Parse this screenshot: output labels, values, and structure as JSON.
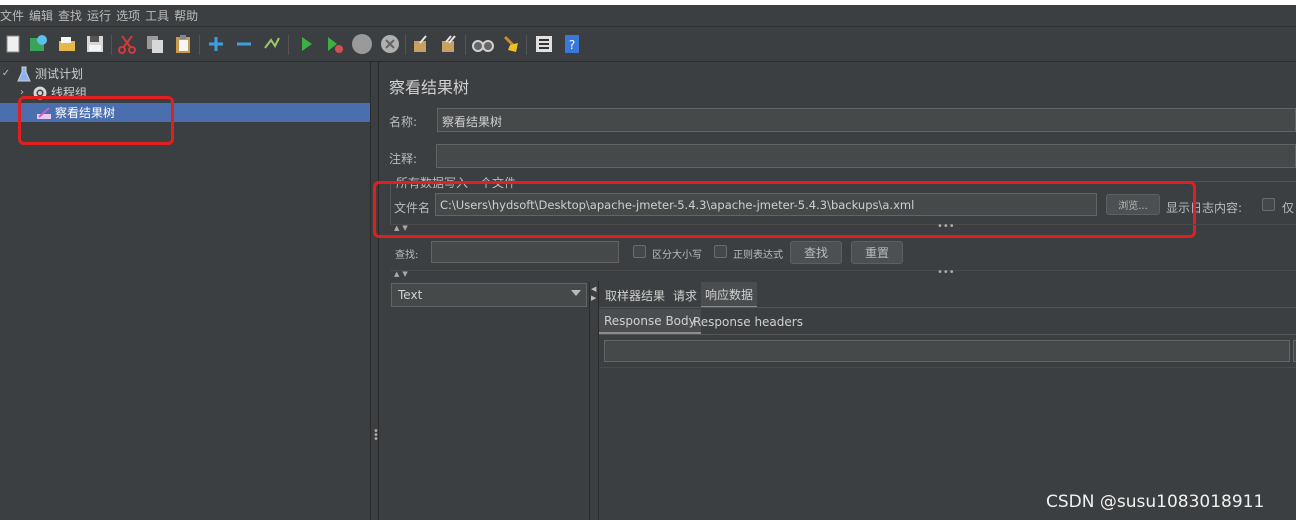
{
  "menu": [
    "文件",
    "编辑",
    "查找",
    "运行",
    "选项",
    "工具",
    "帮助"
  ],
  "toolbar": {
    "icons": [
      "new-icon",
      "templates-icon",
      "open-icon",
      "save-icon",
      "cut-icon",
      "copy-icon",
      "paste-icon",
      "expand-icon",
      "collapse-icon",
      "toggle-icon",
      "start-icon",
      "start-no-pause-icon",
      "stop-icon",
      "shutdown-icon",
      "clear-icon",
      "clear-all-icon",
      "search-icon",
      "reset-search-icon",
      "function-helper-icon",
      "help-icon"
    ],
    "colors": {
      "new-icon": "#f0f0f0",
      "templates-icon": "#3aa35a",
      "open-icon": "#e6b84a",
      "save-icon": "#d8d8d8",
      "cut-icon": "#d03a3a",
      "copy-icon": "#c8c8c8",
      "paste-icon": "#e0c070",
      "expand-icon": "#3b9fe0",
      "collapse-icon": "#3b9fe0",
      "toggle-icon": "#9bc86a",
      "start-icon": "#3cb043",
      "start-no-pause-icon": "#3cb043",
      "stop-icon": "#9a9a9a",
      "shutdown-icon": "#9a9a9a",
      "clear-icon": "#c8a060",
      "clear-all-icon": "#c8a060",
      "search-icon": "#d0d0d0",
      "reset-search-icon": "#f0c020",
      "function-helper-icon": "#e0e0e0",
      "help-icon": "#3a78d8"
    }
  },
  "tree": {
    "items": [
      {
        "label": "测试计划",
        "icon": "test-plan-icon",
        "expanded": true
      },
      {
        "label": "线程组",
        "icon": "thread-group-icon",
        "expanded": false
      },
      {
        "label": "察看结果树",
        "icon": "listener-icon",
        "selected": true
      }
    ]
  },
  "panel": {
    "title": "察看结果树",
    "name_label": "名称:",
    "name_value": "察看结果树",
    "comment_label": "注释:",
    "comment_value": "",
    "section_label": "所有数据写入一个文件",
    "filename_label": "文件名",
    "filename_value": "C:\\Users\\hydsoft\\Desktop\\apache-jmeter-5.4.3\\apache-jmeter-5.4.3\\backups\\a.xml",
    "browse_label": "浏览...",
    "log_label": "显示日志内容:",
    "only_label": "仅",
    "search_label": "查找:",
    "case_label": "区分大小写",
    "regex_label": "正则表达式",
    "find_button": "查找",
    "reset_button": "重置",
    "renderer_selected": "Text",
    "tabs": [
      "取样器结果",
      "请求",
      "响应数据"
    ],
    "active_tab": "响应数据",
    "subtabs": [
      "Response Body",
      "Response headers"
    ],
    "active_subtab": "Response Body"
  },
  "watermark": "CSDN @susu1083018911",
  "annotation_color": "#e02020"
}
